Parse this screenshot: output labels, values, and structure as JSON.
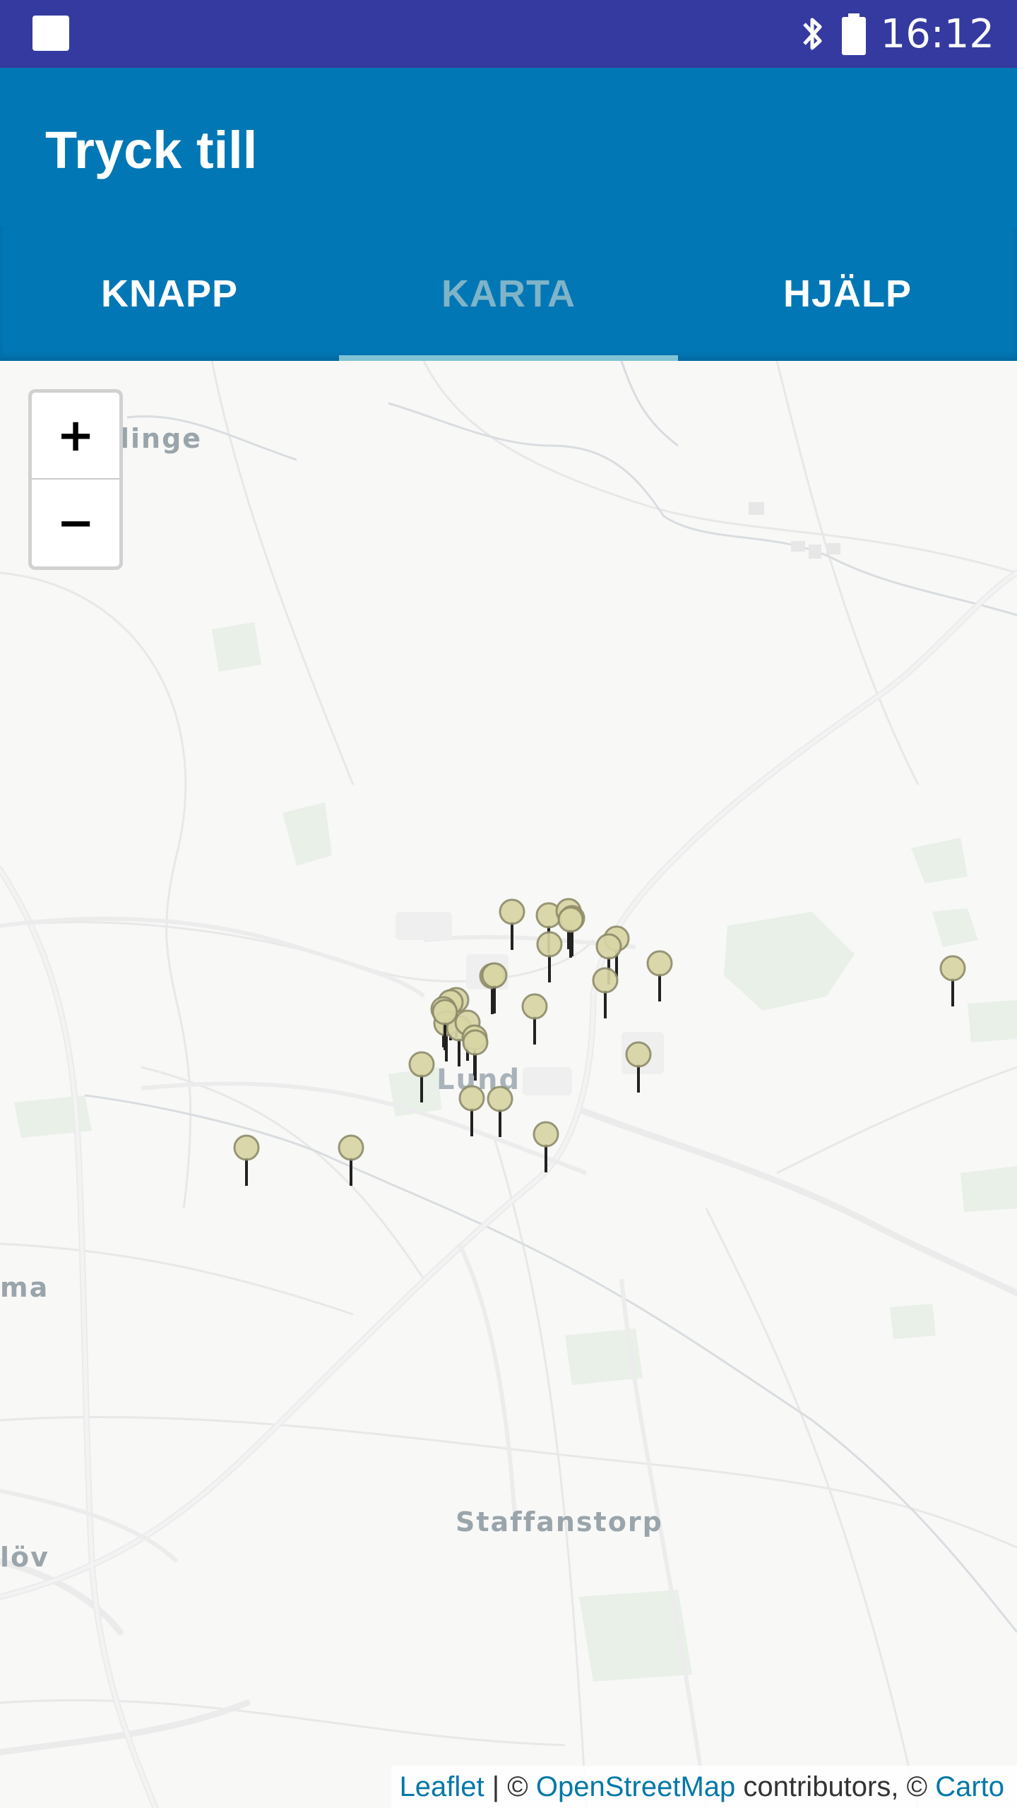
{
  "status_bar": {
    "time": "16:12"
  },
  "app_bar": {
    "title": "Tryck till"
  },
  "tabs": [
    {
      "label": "KNAPP",
      "active": false
    },
    {
      "label": "KARTA",
      "active": true
    },
    {
      "label": "HJÄLP",
      "active": false
    }
  ],
  "map": {
    "zoom_in_label": "+",
    "zoom_out_label": "−",
    "places": {
      "linge": "linge",
      "lund": "Lund",
      "ma": "ma",
      "staffanstorp": "Staffanstorp",
      "lov": "löv"
    },
    "attribution": {
      "leaflet": "Leaflet",
      "sep1": " | © ",
      "osm": "OpenStreetMap",
      "contrib": " contributors, © ",
      "carto": "Carto"
    },
    "marker_count": 30
  },
  "colors": {
    "status_bar": "#343a9f",
    "app_bar": "#0277b5",
    "tab_indicator": "#80c4d4",
    "marker_fill": "#d8d6a4"
  }
}
